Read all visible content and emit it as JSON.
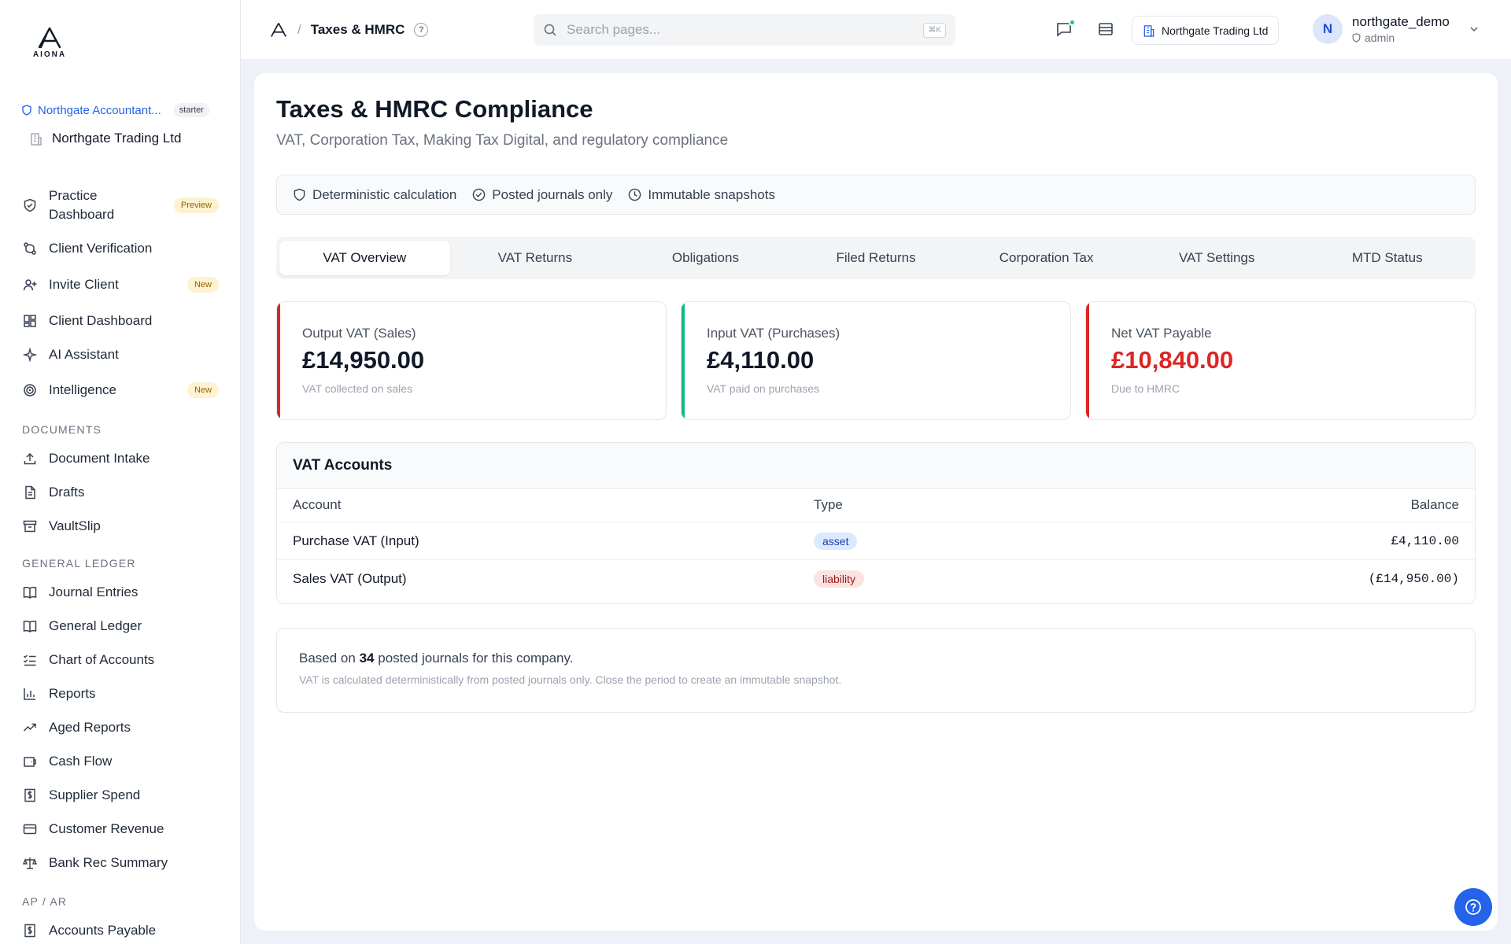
{
  "app": {
    "logo_text": "AIONA"
  },
  "sidebar": {
    "org_name": "Northgate Accountant...",
    "plan_badge": "starter",
    "company_name": "Northgate Trading Ltd",
    "items": [
      {
        "label": "Practice Dashboard",
        "badge": "Preview"
      },
      {
        "label": "Client Verification"
      },
      {
        "label": "Invite Client",
        "badge": "New"
      },
      {
        "label": "Client Dashboard"
      },
      {
        "label": "AI Assistant"
      },
      {
        "label": "Intelligence",
        "badge": "New"
      }
    ],
    "sections": {
      "documents": "DOCUMENTS",
      "general_ledger": "GENERAL LEDGER",
      "ap_ar": "AP / AR"
    },
    "documents_items": [
      {
        "label": "Document Intake"
      },
      {
        "label": "Drafts"
      },
      {
        "label": "VaultSlip"
      }
    ],
    "ledger_items": [
      {
        "label": "Journal Entries"
      },
      {
        "label": "General Ledger"
      },
      {
        "label": "Chart of Accounts"
      },
      {
        "label": "Reports"
      },
      {
        "label": "Aged Reports"
      },
      {
        "label": "Cash Flow"
      },
      {
        "label": "Supplier Spend"
      },
      {
        "label": "Customer Revenue"
      },
      {
        "label": "Bank Rec Summary"
      }
    ],
    "apar_items": [
      {
        "label": "Accounts Payable"
      }
    ]
  },
  "topbar": {
    "breadcrumb": "Taxes & HMRC",
    "help_glyph": "?",
    "search_placeholder": "Search pages...",
    "search_shortcut": "⌘K",
    "company_button": "Northgate Trading Ltd",
    "user": {
      "initial": "N",
      "name": "northgate_demo",
      "role": "admin"
    }
  },
  "page": {
    "title": "Taxes & HMRC Compliance",
    "subtitle": "VAT, Corporation Tax, Making Tax Digital, and regulatory compliance",
    "assurances": [
      "Deterministic calculation",
      "Posted journals only",
      "Immutable snapshots"
    ],
    "tabs": [
      "VAT Overview",
      "VAT Returns",
      "Obligations",
      "Filed Returns",
      "Corporation Tax",
      "VAT Settings",
      "MTD Status"
    ],
    "active_tab": "VAT Overview",
    "stats": [
      {
        "label": "Output VAT (Sales)",
        "value": "£14,950.00",
        "note": "VAT collected on sales",
        "accent": "#dc2626"
      },
      {
        "label": "Input VAT (Purchases)",
        "value": "£4,110.00",
        "note": "VAT paid on purchases",
        "accent": "#10b981"
      },
      {
        "label": "Net VAT Payable",
        "value": "£10,840.00",
        "note": "Due to HMRC",
        "accent": "#dc2626"
      }
    ],
    "vat_accounts": {
      "title": "VAT Accounts",
      "columns": [
        "Account",
        "Type",
        "Balance"
      ],
      "rows": [
        {
          "account": "Purchase VAT (Input)",
          "type": "asset",
          "balance": "£4,110.00"
        },
        {
          "account": "Sales VAT (Output)",
          "type": "liability",
          "balance": "(£14,950.00)"
        }
      ]
    },
    "footnote": {
      "prefix": "Based on",
      "count": "34",
      "suffix": "posted journals for this company.",
      "detail": "VAT is calculated deterministically from posted journals only. Close the period to create an immutable snapshot."
    }
  },
  "colors": {
    "accent": "#2563eb",
    "danger": "#dc2626",
    "success": "#10b981"
  }
}
